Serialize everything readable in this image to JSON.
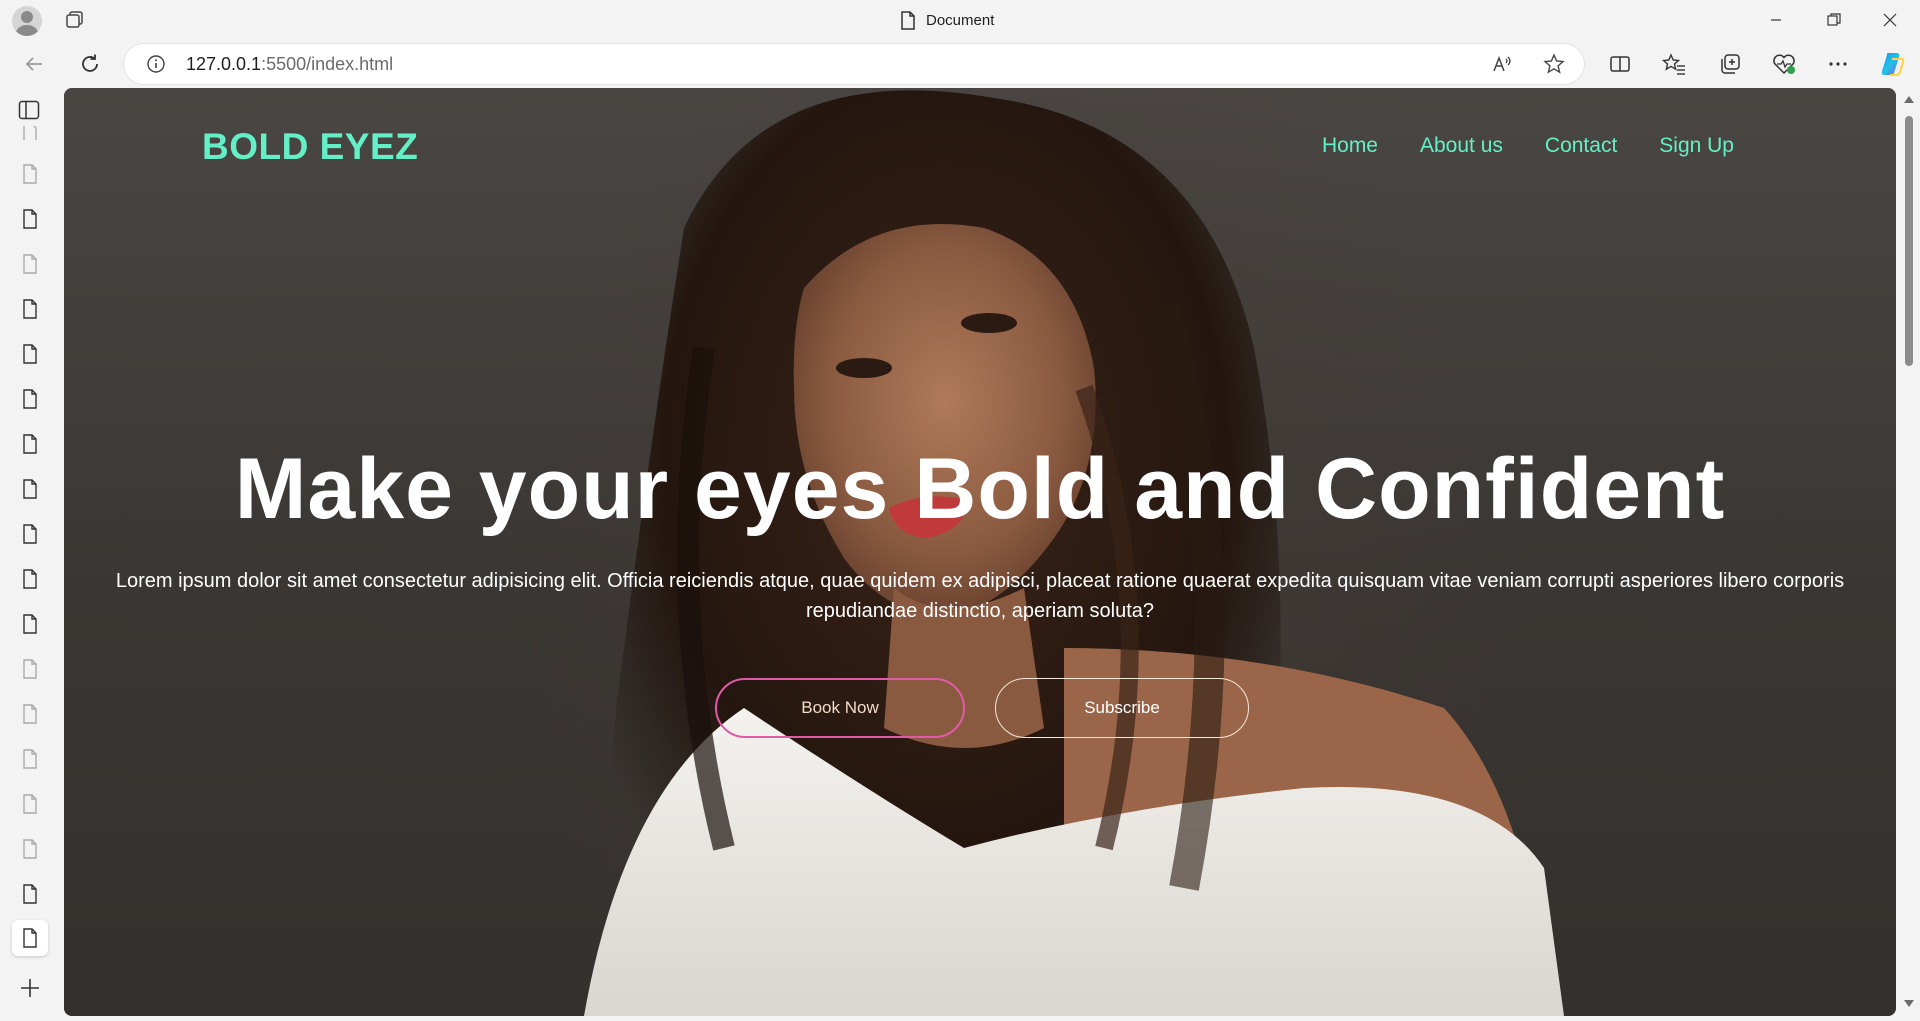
{
  "browser": {
    "window_title": "Document",
    "url_host": "127.0.0.1",
    "url_rest": ":5500/index.html"
  },
  "page": {
    "logo": "BOLD EYEZ",
    "nav": [
      "Home",
      "About us",
      "Contact",
      "Sign Up"
    ],
    "hero_title": "Make your eyes Bold and Confident",
    "hero_text": "Lorem ipsum dolor sit amet consectetur adipisicing elit. Officia reiciendis atque, quae quidem ex adipisci, placeat ratione quaerat expedita quisquam vitae veniam corrupti asperiores libero corporis repudiandae distinctio, aperiam soluta?",
    "book_button": "Book Now",
    "subscribe_button": "Subscribe"
  },
  "colors": {
    "accent": "#64f0c7",
    "book_border": "#e15aa9",
    "background": "#3c3835"
  },
  "icons": {
    "profile": "avatar-icon",
    "tabs": "tab-actions-icon",
    "page": "document-icon",
    "back": "back-arrow-icon",
    "refresh": "refresh-icon",
    "info": "info-icon",
    "read_aloud": "read-aloud-icon",
    "favorite": "star-icon",
    "split": "split-screen-icon",
    "favorites": "favorites-icon",
    "collections": "collections-icon",
    "health": "browser-essentials-icon",
    "more": "more-icon",
    "copilot": "copilot-icon"
  }
}
